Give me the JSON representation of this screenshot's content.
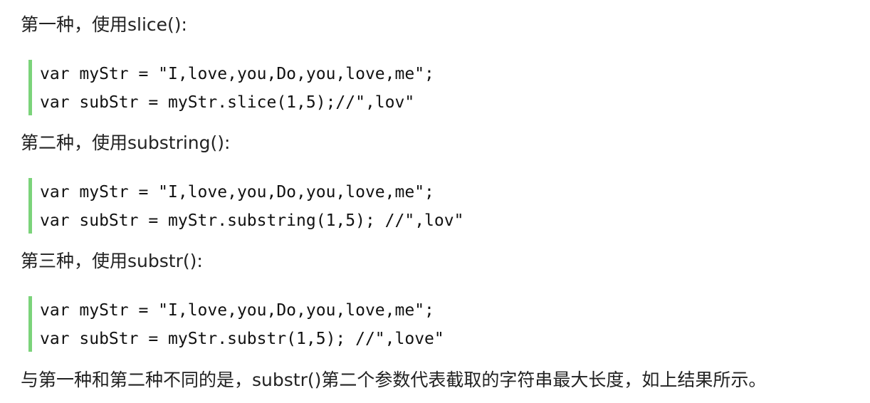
{
  "sections": [
    {
      "heading": "第一种，使用slice():",
      "code": [
        "var myStr = \"I,love,you,Do,you,love,me\";",
        "var subStr = myStr.slice(1,5);//\",lov\""
      ]
    },
    {
      "heading": "第二种，使用substring():",
      "code": [
        "var myStr = \"I,love,you,Do,you,love,me\";",
        "var subStr = myStr.substring(1,5); //\",lov\""
      ]
    },
    {
      "heading": "第三种，使用substr():",
      "code": [
        "var myStr = \"I,love,you,Do,you,love,me\";",
        "var subStr = myStr.substr(1,5); //\",love\""
      ]
    }
  ],
  "note": "与第一种和第二种不同的是，substr()第二个参数代表截取的字符串最大长度，如上结果所示。",
  "colors": {
    "code_border": "#7bd37a",
    "text": "#222222"
  }
}
